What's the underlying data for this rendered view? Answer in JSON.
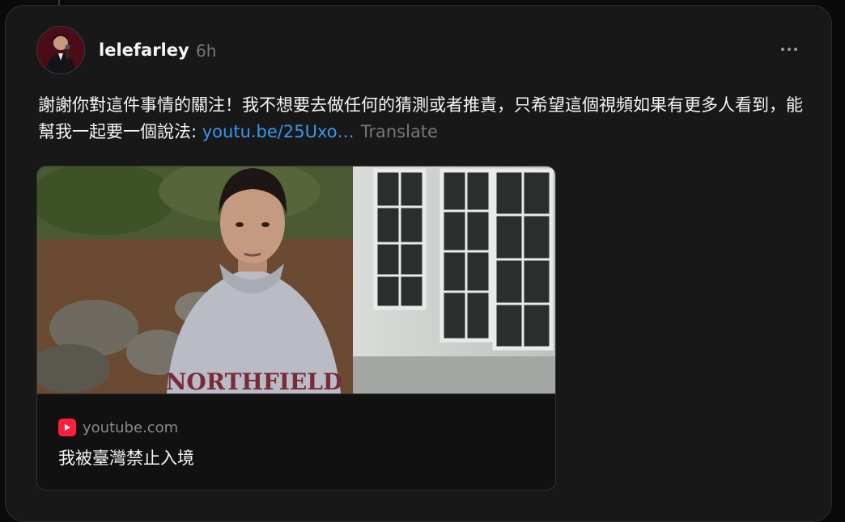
{
  "post": {
    "username": "lelefarley",
    "timestamp": "6h",
    "text_main": "謝謝你對這件事情的關注！我不想要去做任何的猜測或者推責，只希望這個視頻如果有更多人看到，能幫我一起要一個說法: ",
    "link_text": "youtu.be/25Uxo…",
    "translate_label": "Translate"
  },
  "link_preview": {
    "domain": "youtube.com",
    "title": "我被臺灣禁止入境",
    "thumbnail_text": "NORTHFIELD"
  },
  "icons": {
    "avatar": "user-avatar",
    "more": "more-horizontal-icon",
    "source": "youtube-logo-icon"
  },
  "colors": {
    "background": "#181818",
    "link": "#3897f0",
    "muted": "#777777",
    "youtube_red": "#ff1e3c"
  }
}
